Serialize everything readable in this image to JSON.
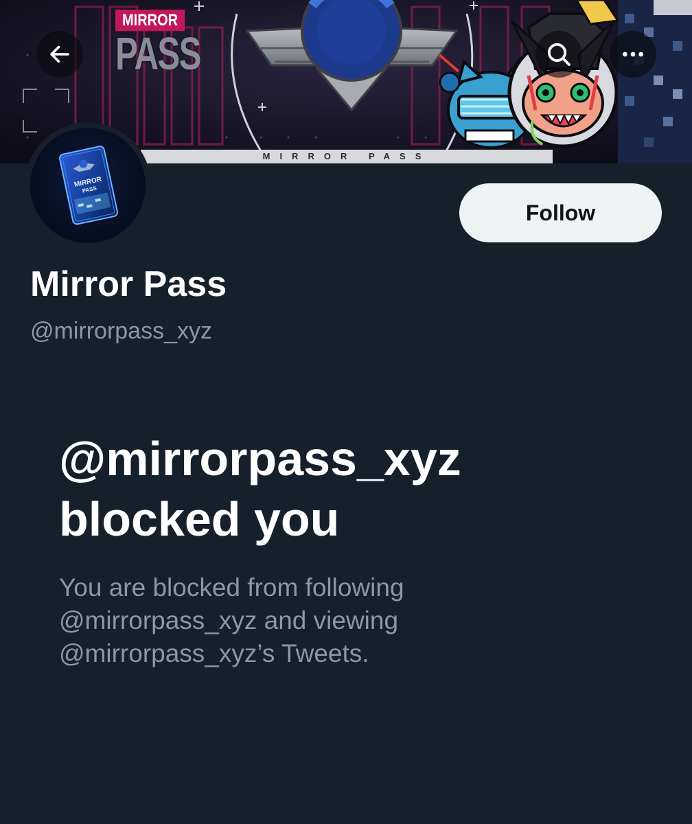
{
  "banner": {
    "logo_top": "MIRROR",
    "logo_bottom": "PASS",
    "strip_text": "MIRROR PASS"
  },
  "nav": {
    "back_icon": "arrow-left-icon",
    "search_icon": "search-icon",
    "more_icon": "more-horizontal-icon"
  },
  "avatar": {
    "card_text_top": "MIRROR",
    "card_text_bottom": "PASS"
  },
  "profile": {
    "display_name": "Mirror Pass",
    "handle": "@mirrorpass_xyz",
    "follow_label": "Follow"
  },
  "blocked": {
    "title_line1": "@mirrorpass_xyz",
    "title_line2": "blocked you",
    "desc_line1": "You are blocked from following",
    "desc_line2": "@mirrorpass_xyz and viewing",
    "desc_line3": "@mirrorpass_xyz’s Tweets."
  },
  "colors": {
    "background": "#15202b",
    "follow_bg": "#eff3f4",
    "primary_text": "#ffffff",
    "secondary_text": "#8b98a5",
    "banner_accent": "#c2185b"
  }
}
